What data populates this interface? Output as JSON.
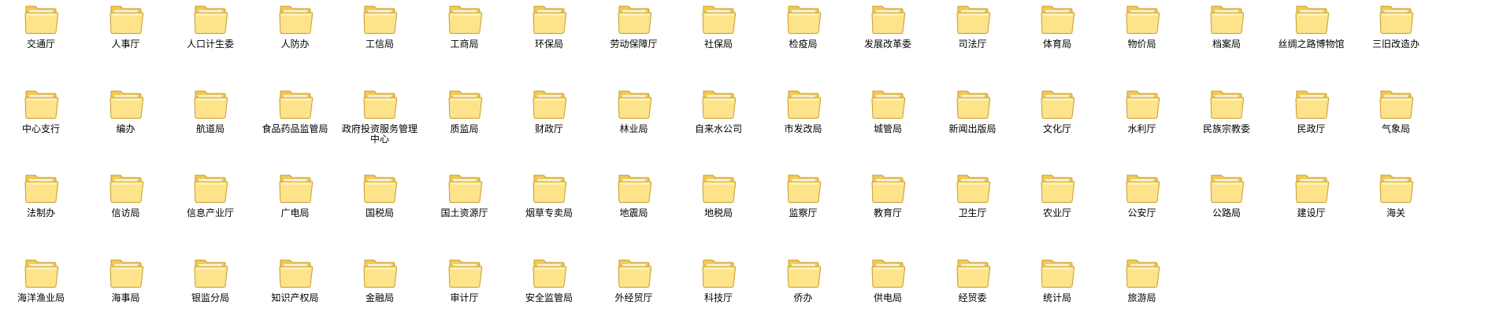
{
  "colors": {
    "folder_body": "#fde48a",
    "folder_back": "#f3c94f",
    "folder_outline": "#c89a2a",
    "label_text": "#000000",
    "background": "#ffffff"
  },
  "icon": "folder-icon",
  "rows": [
    [
      "交通厅",
      "人事厅",
      "人口计生委",
      "人防办",
      "工信局",
      "工商局",
      "环保局",
      "劳动保障厅",
      "社保局",
      "检疫局",
      "发展改革委",
      "司法厅",
      "体育局",
      "物价局",
      "档案局",
      "丝绸之路博物馆",
      "三旧改造办"
    ],
    [
      "中心支行",
      "编办",
      "航道局",
      "食品药品监管局",
      "政府投资服务管理中心",
      "质监局",
      "财政厅",
      "林业局",
      "自来水公司",
      "市发改局",
      "城管局",
      "新闻出版局",
      "文化厅",
      "水利厅",
      "民族宗教委",
      "民政厅",
      "气象局"
    ],
    [
      "法制办",
      "信访局",
      "信息产业厅",
      "广电局",
      "国税局",
      "国土资源厅",
      "烟草专卖局",
      "地震局",
      "地税局",
      "监察厅",
      "教育厅",
      "卫生厅",
      "农业厅",
      "公安厅",
      "公路局",
      "建设厅",
      "海关"
    ],
    [
      "海洋渔业局",
      "海事局",
      "银监分局",
      "知识产权局",
      "金融局",
      "审计厅",
      "安全监管局",
      "外经贸厅",
      "科技厅",
      "侨办",
      "供电局",
      "经贸委",
      "统计局",
      "旅游局"
    ]
  ]
}
